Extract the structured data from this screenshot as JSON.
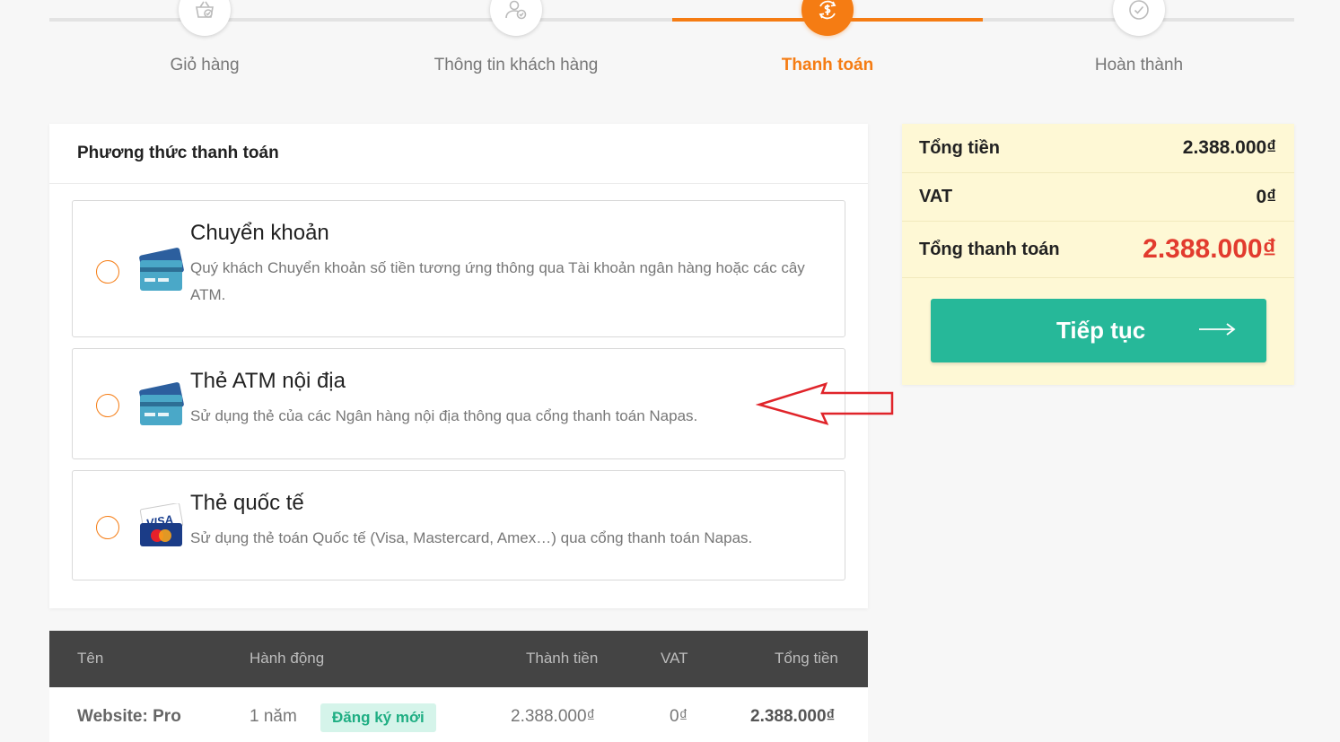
{
  "stepper": {
    "steps": [
      {
        "label": "Giỏ hàng",
        "icon": "cart-check-icon",
        "active": false
      },
      {
        "label": "Thông tin khách hàng",
        "icon": "user-check-icon",
        "active": false
      },
      {
        "label": "Thanh toán",
        "icon": "payment-dollar-icon",
        "active": true
      },
      {
        "label": "Hoàn thành",
        "icon": "check-circle-icon",
        "active": false
      }
    ],
    "accent_color": "#f57c13"
  },
  "payment": {
    "title": "Phương thức thanh toán",
    "methods": [
      {
        "title": "Chuyển khoản",
        "description": "Quý khách Chuyển khoản số tiền tương ứng thông qua Tài khoản ngân hàng hoặc các cây ATM.",
        "icon": "bank-card-icon"
      },
      {
        "title": "Thẻ ATM nội địa",
        "description": "Sử dụng thẻ của các Ngân hàng nội địa thông qua cổng thanh toán Napas.",
        "icon": "atm-card-icon"
      },
      {
        "title": "Thẻ quốc tế",
        "description": "Sử dụng thẻ toán Quốc tế (Visa, Mastercard, Amex…) qua cổng thanh toán Napas.",
        "icon": "visa-mastercard-icon",
        "icon_text": "VISA"
      }
    ]
  },
  "summary": {
    "total_label": "Tổng tiền",
    "total_value": "2.388.000₫",
    "vat_label": "VAT",
    "vat_value": "0₫",
    "grand_label": "Tổng thanh toán",
    "grand_value": "2.388.000₫",
    "continue_label": "Tiếp tục",
    "button_color": "#26b899",
    "grand_color": "#e23b2e"
  },
  "table": {
    "headers": {
      "name": "Tên",
      "action": "Hành động",
      "amount": "Thành tiền",
      "vat": "VAT",
      "total": "Tổng tiền"
    },
    "rows": [
      {
        "name_prefix": "Website",
        "name_value": "Pro",
        "duration": "1 năm",
        "tag": "Đăng ký mới",
        "amount": "2.388.000₫",
        "vat": "0₫",
        "total": "2.388.000₫"
      }
    ]
  }
}
